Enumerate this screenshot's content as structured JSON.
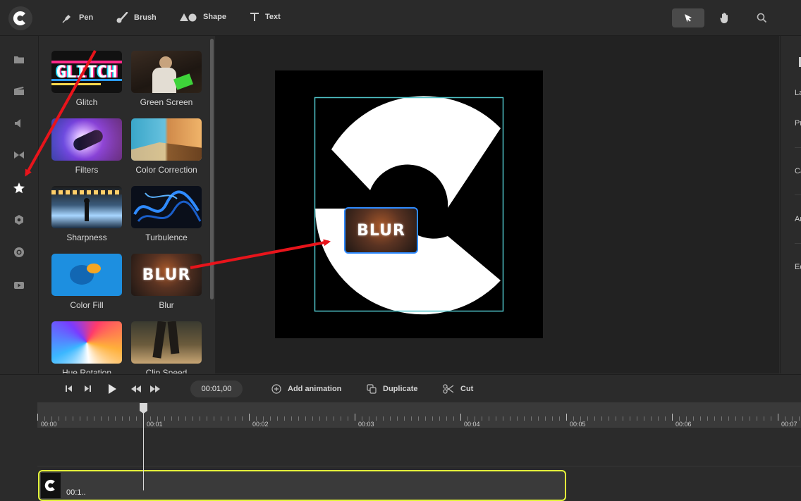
{
  "toolbar": {
    "tools": [
      {
        "label": "Pen",
        "icon": "pen-icon"
      },
      {
        "label": "Brush",
        "icon": "brush-icon"
      },
      {
        "label": "Shape",
        "icon": "shape-icon"
      },
      {
        "label": "Text",
        "icon": "text-icon"
      }
    ],
    "right_tools": [
      "select-pointer-icon",
      "hand-icon",
      "search-icon"
    ]
  },
  "rail": {
    "items": [
      "folder-icon",
      "clapperboard-icon",
      "speaker-icon",
      "transition-icon",
      "star-icon",
      "hexagon-icon",
      "record-icon",
      "video-icon"
    ],
    "active": "star-icon"
  },
  "effects": {
    "items": [
      {
        "label": "Glitch",
        "thumb_text": "GLITCH"
      },
      {
        "label": "Green Screen"
      },
      {
        "label": "Filters"
      },
      {
        "label": "Color Correction"
      },
      {
        "label": "Sharpness"
      },
      {
        "label": "Turbulence"
      },
      {
        "label": "Color Fill"
      },
      {
        "label": "Blur",
        "thumb_text": "BLUR"
      },
      {
        "label": "Hue Rotation"
      },
      {
        "label": "Clip Speed"
      }
    ]
  },
  "canvas": {
    "drag_preview_text": "BLUR",
    "selection_color": "#4fc3c8"
  },
  "right_panel": {
    "labels": [
      "La",
      "Pr",
      "Ca",
      "Ar",
      "Ed"
    ]
  },
  "timeline": {
    "timecode": "00:01,00",
    "actions": [
      {
        "label": "Add animation",
        "icon": "add-circle-icon"
      },
      {
        "label": "Duplicate",
        "icon": "duplicate-icon"
      },
      {
        "label": "Cut",
        "icon": "scissors-icon"
      }
    ],
    "ruler_labels": [
      "00:00",
      "00:01",
      "00:02",
      "00:03",
      "00:04",
      "00:05",
      "00:06",
      "00:07"
    ],
    "clip_label": "00:1..",
    "clip_border_color": "#e4f53a"
  },
  "colors": {
    "annotation_arrow": "#e8141b"
  }
}
